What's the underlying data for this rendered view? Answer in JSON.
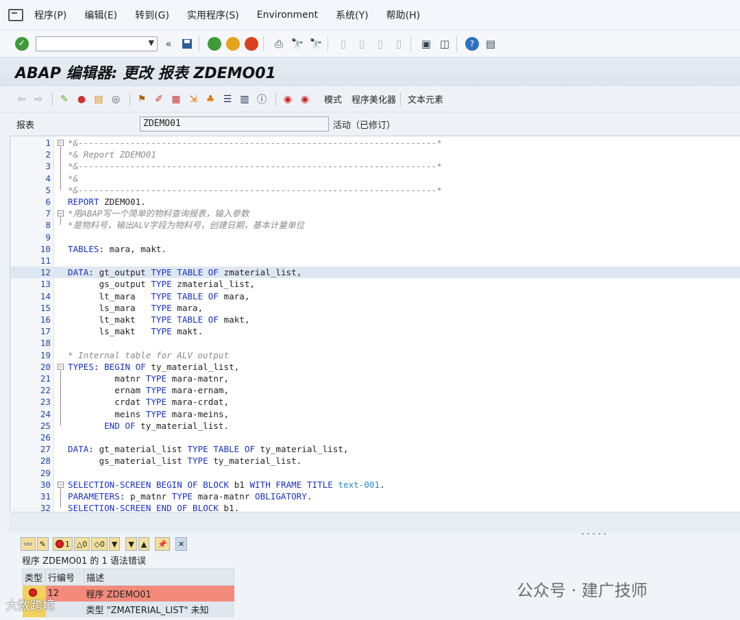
{
  "menu": [
    "程序(P)",
    "编辑(E)",
    "转到(G)",
    "实用程序(S)",
    "Environment",
    "系统(Y)",
    "帮助(H)"
  ],
  "toolbar": {
    "cmd_value": "",
    "back_glyph": "«"
  },
  "title": "ABAP 编辑器: 更改 报表 ZDEMO01",
  "app_toolbar": {
    "mode": "模式",
    "pretty_printer": "程序美化器",
    "text_elements": "文本元素"
  },
  "report_field": {
    "label": "报表",
    "value": "ZDEMO01",
    "status": "活动（已修订）"
  },
  "code_lines": [
    {
      "n": "1",
      "t": "*&---------------------------------------------------------------------*",
      "c": "cm",
      "fold": "open"
    },
    {
      "n": "2",
      "t": "*& Report ZDEMO01",
      "c": "cm"
    },
    {
      "n": "3",
      "t": "*&---------------------------------------------------------------------*",
      "c": "cm"
    },
    {
      "n": "4",
      "t": "*&",
      "c": "cm"
    },
    {
      "n": "5",
      "t": "*&---------------------------------------------------------------------*",
      "c": "cm",
      "fold": "end"
    },
    {
      "n": "6",
      "t": "REPORT ZDEMO01.",
      "c": "mix"
    },
    {
      "n": "7",
      "t": "*用ABAP写一个简单的物料查询报表，输入参数",
      "c": "cm",
      "fold": "open"
    },
    {
      "n": "8",
      "t": "*是物料号，输出ALV字段为物料号，创建日期，基本计量单位",
      "c": "cm",
      "fold": "end"
    },
    {
      "n": "9",
      "t": "",
      "c": ""
    },
    {
      "n": "10",
      "t": "TABLES: mara, makt.",
      "c": "mix"
    },
    {
      "n": "11",
      "t": "",
      "c": ""
    },
    {
      "n": "12",
      "t": "DATA: gt_output TYPE TABLE OF zmaterial_list,",
      "c": "mix",
      "hl": true
    },
    {
      "n": "13",
      "t": "      gs_output TYPE zmaterial_list,",
      "c": "mix"
    },
    {
      "n": "14",
      "t": "      lt_mara   TYPE TABLE OF mara,",
      "c": "mix"
    },
    {
      "n": "15",
      "t": "      ls_mara   TYPE mara,",
      "c": "mix"
    },
    {
      "n": "16",
      "t": "      lt_makt   TYPE TABLE OF makt,",
      "c": "mix"
    },
    {
      "n": "17",
      "t": "      ls_makt   TYPE makt.",
      "c": "mix"
    },
    {
      "n": "18",
      "t": "",
      "c": ""
    },
    {
      "n": "19",
      "t": "* Internal table for ALV output",
      "c": "cm"
    },
    {
      "n": "20",
      "t": "TYPES: BEGIN OF ty_material_list,",
      "c": "mix",
      "fold": "open"
    },
    {
      "n": "21",
      "t": "         matnr TYPE mara-matnr,",
      "c": "mix"
    },
    {
      "n": "22",
      "t": "         ernam TYPE mara-ernam,",
      "c": "mix"
    },
    {
      "n": "23",
      "t": "         crdat TYPE mara-crdat,",
      "c": "mix"
    },
    {
      "n": "24",
      "t": "         meins TYPE mara-meins,",
      "c": "mix"
    },
    {
      "n": "25",
      "t": "       END OF ty_material_list.",
      "c": "mix",
      "fold": "end"
    },
    {
      "n": "26",
      "t": "",
      "c": ""
    },
    {
      "n": "27",
      "t": "DATA: gt_material_list TYPE TABLE OF ty_material_list,",
      "c": "mix"
    },
    {
      "n": "28",
      "t": "      gs_material_list TYPE ty_material_list.",
      "c": "mix"
    },
    {
      "n": "29",
      "t": "",
      "c": ""
    },
    {
      "n": "30",
      "t": "SELECTION-SCREEN BEGIN OF BLOCK b1 WITH FRAME TITLE text-001.",
      "c": "mix",
      "fold": "open"
    },
    {
      "n": "31",
      "t": "PARAMETERS: p_matnr TYPE mara-matnr OBLIGATORY.",
      "c": "mix"
    },
    {
      "n": "32",
      "t": "SELECTION-SCREEN END OF BLOCK b1.",
      "c": "mix",
      "fold": "end"
    }
  ],
  "error_panel": {
    "toolbar_counts": [
      "1",
      "0",
      "0"
    ],
    "message": "程序 ZDEMO01 的 1 语法错误",
    "headers": [
      "类型",
      "行编号",
      "描述"
    ],
    "rows": [
      {
        "line": "12",
        "desc": "程序 ZDEMO01"
      },
      {
        "line": "",
        "desc": "类型 \"ZMATERIAL_LIST\" 未知"
      }
    ]
  },
  "watermarks": {
    "publisher": "公众号 · 建广技师",
    "brand": "大数跨境"
  },
  "colors": {
    "keyword": "#1730c8",
    "comment": "#8a8a8a",
    "error_row": "#f48a7a",
    "highlight": "#dfe8f2"
  }
}
